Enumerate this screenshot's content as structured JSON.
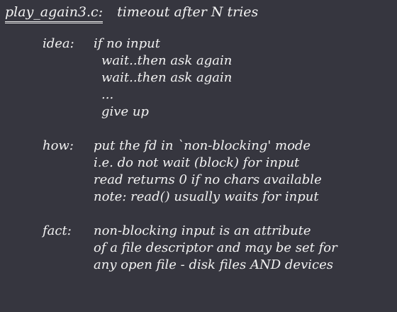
{
  "title": {
    "filename": "play_again3.c:",
    "description": "timeout after  N   tries"
  },
  "idea": {
    "label": "idea:",
    "first_line": "if no input",
    "lines": [
      "wait..then ask again",
      "wait..then ask again",
      "...",
      "give up"
    ]
  },
  "how": {
    "label": "how:",
    "lines": [
      "put the fd in `non-blocking' mode",
      "i.e. do not wait (block) for input",
      "read returns 0 if no chars available",
      "note: read() usually waits for input"
    ]
  },
  "fact": {
    "label": "fact:",
    "lines": [
      "non-blocking input is an attribute",
      "of a file descriptor and may be set for",
      "any open file -  disk files AND devices"
    ]
  }
}
